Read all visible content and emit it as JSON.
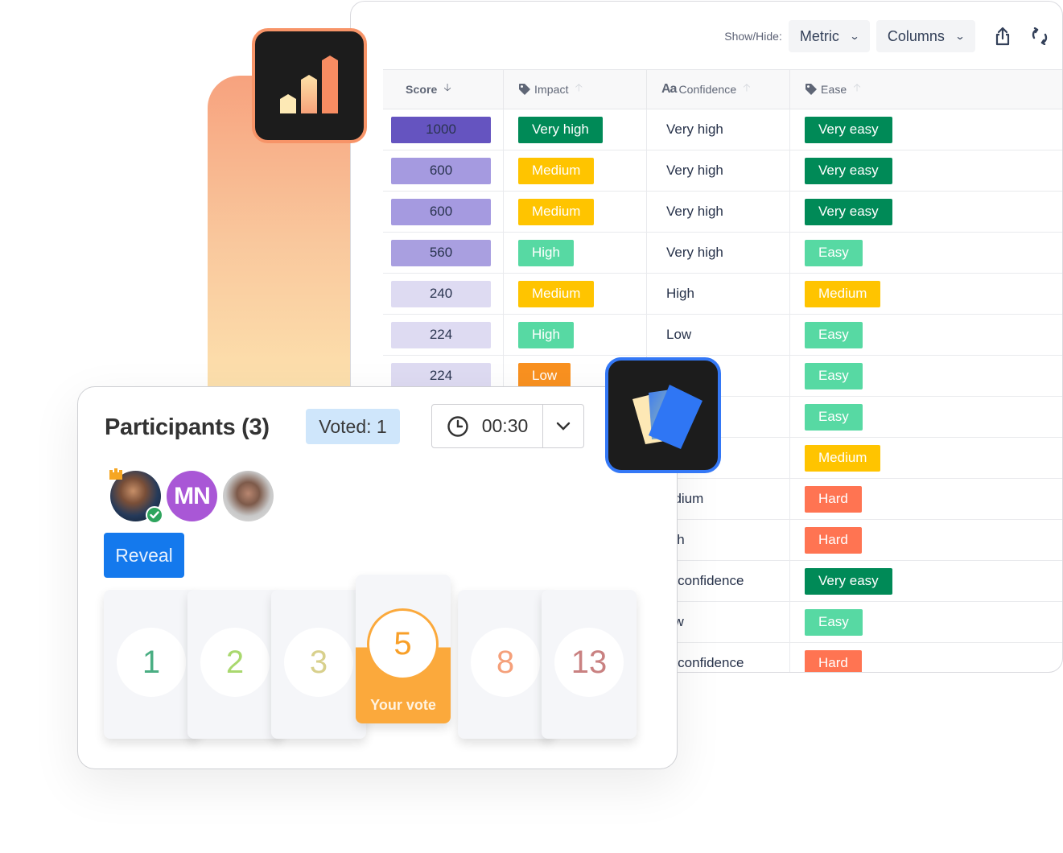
{
  "toolbar": {
    "show_hide_label": "Show/Hide:",
    "metric_label": "Metric",
    "columns_label": "Columns",
    "share_icon": "share-icon",
    "refresh_icon": "refresh-icon"
  },
  "table": {
    "headers": [
      {
        "label": "Score",
        "icon": "none",
        "sort": "desc-active"
      },
      {
        "label": "Impact",
        "icon": "tag-icon",
        "sort": "asc-inactive"
      },
      {
        "label": "Confidence",
        "icon": "text-type-icon",
        "icon_text": "Aa",
        "sort": "asc-inactive"
      },
      {
        "label": "Ease",
        "icon": "tag-icon",
        "sort": "asc-inactive"
      }
    ],
    "rows": [
      {
        "score": "1000",
        "score_color": "#6554c0",
        "impact": "Very high",
        "impact_color": "#008a57",
        "confidence": "Very high",
        "ease": "Very easy",
        "ease_color": "#008a57"
      },
      {
        "score": "600",
        "score_color": "#a59ae0",
        "impact": "Medium",
        "impact_color": "#ffc400",
        "confidence": "Very high",
        "ease": "Very easy",
        "ease_color": "#008a57"
      },
      {
        "score": "600",
        "score_color": "#a59ae0",
        "impact": "Medium",
        "impact_color": "#ffc400",
        "confidence": "Very high",
        "ease": "Very easy",
        "ease_color": "#008a57"
      },
      {
        "score": "560",
        "score_color": "#a99fe0",
        "impact": "High",
        "impact_color": "#57d9a3",
        "confidence": "Very high",
        "ease": "Easy",
        "ease_color": "#57d9a3"
      },
      {
        "score": "240",
        "score_color": "#dedbf2",
        "impact": "Medium",
        "impact_color": "#ffc400",
        "confidence": "High",
        "ease": "Medium",
        "ease_color": "#ffc400"
      },
      {
        "score": "224",
        "score_color": "#dedbf2",
        "impact": "High",
        "impact_color": "#57d9a3",
        "confidence": "Low",
        "ease": "Easy",
        "ease_color": "#57d9a3"
      },
      {
        "score": "224",
        "score_color": "#dedbf2",
        "impact": "Low",
        "impact_color": "#f99120",
        "confidence": "",
        "ease": "Easy",
        "ease_color": "#57d9a3"
      },
      {
        "score": "",
        "score_color": "",
        "impact": "",
        "impact_color": "",
        "confidence": "",
        "ease": "Easy",
        "ease_color": "#57d9a3"
      },
      {
        "score": "",
        "score_color": "",
        "impact": "",
        "impact_color": "",
        "confidence": "",
        "ease": "Medium",
        "ease_color": "#ffc400"
      },
      {
        "score": "",
        "score_color": "",
        "impact": "",
        "impact_color": "",
        "confidence": "edium",
        "ease": "Hard",
        "ease_color": "#ff7452"
      },
      {
        "score": "",
        "score_color": "",
        "impact": "",
        "impact_color": "",
        "confidence": "igh",
        "ease": "Hard",
        "ease_color": "#ff7452"
      },
      {
        "score": "",
        "score_color": "",
        "impact": "",
        "impact_color": "",
        "confidence": "o confidence",
        "ease": "Very easy",
        "ease_color": "#008a57"
      },
      {
        "score": "",
        "score_color": "",
        "impact": "",
        "impact_color": "",
        "confidence": "ow",
        "ease": "Easy",
        "ease_color": "#57d9a3"
      },
      {
        "score": "",
        "score_color": "",
        "impact": "",
        "impact_color": "",
        "confidence": "o confidence",
        "ease": "Hard",
        "ease_color": "#ff7452"
      }
    ]
  },
  "apps": {
    "chart_app_icon": "bar-chart-app-icon",
    "cards_app_icon": "planning-cards-app-icon",
    "chart_accent": "#f79468",
    "cards_accent": "#3478f6"
  },
  "voting": {
    "title": "Participants (3)",
    "voted_badge": "Voted: 1",
    "timer_value": "00:30",
    "participants": [
      {
        "type": "photo",
        "is_host": true,
        "has_voted": true
      },
      {
        "type": "initials",
        "initials": "MN",
        "color": "#a957d6"
      },
      {
        "type": "photo"
      }
    ],
    "reveal_label": "Reveal",
    "cards": [
      {
        "value": "1",
        "color": "#4aae83"
      },
      {
        "value": "2",
        "color": "#a9d86e"
      },
      {
        "value": "3",
        "color": "#d8d08c"
      },
      {
        "value": "5",
        "color": "#f89f28",
        "selected": true
      },
      {
        "value": "8",
        "color": "#f5a07a"
      },
      {
        "value": "13",
        "color": "#c98181"
      }
    ],
    "your_vote_label": "Your vote"
  }
}
